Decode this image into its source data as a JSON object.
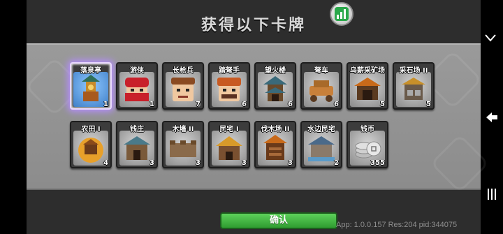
{
  "title": "获得以下卡牌",
  "confirm_label": "确认",
  "version_text": "App: 1.0.0.157 Res:204 pid:344075",
  "icons": {
    "stats": "stats-chart-icon",
    "dropdown": "chevron-down-icon",
    "back": "back-arrow-icon",
    "menu": "recent-apps-icon"
  },
  "colors": {
    "confirm_green": "#3fb43d",
    "highlight_purple": "#b48cff",
    "panel_gray": "#959595"
  },
  "cards": [
    {
      "name": "落泉亭",
      "count": "1"
    },
    {
      "name": "游侠",
      "count": "1"
    },
    {
      "name": "长枪兵",
      "count": "7"
    },
    {
      "name": "踏弩手",
      "count": "6"
    },
    {
      "name": "望火楼",
      "count": "6"
    },
    {
      "name": "弩车",
      "count": "6"
    },
    {
      "name": "乌薪采矿场",
      "count": "5"
    },
    {
      "name": "采石场 II",
      "count": "5"
    },
    {
      "name": "农田 I",
      "count": "4"
    },
    {
      "name": "钱庄",
      "count": "3"
    },
    {
      "name": "木墙 II",
      "count": "3"
    },
    {
      "name": "民宅 I",
      "count": "3"
    },
    {
      "name": "伐木场 II",
      "count": "3"
    },
    {
      "name": "水边民宅",
      "count": "2"
    },
    {
      "name": "钱币",
      "count": "355"
    }
  ]
}
